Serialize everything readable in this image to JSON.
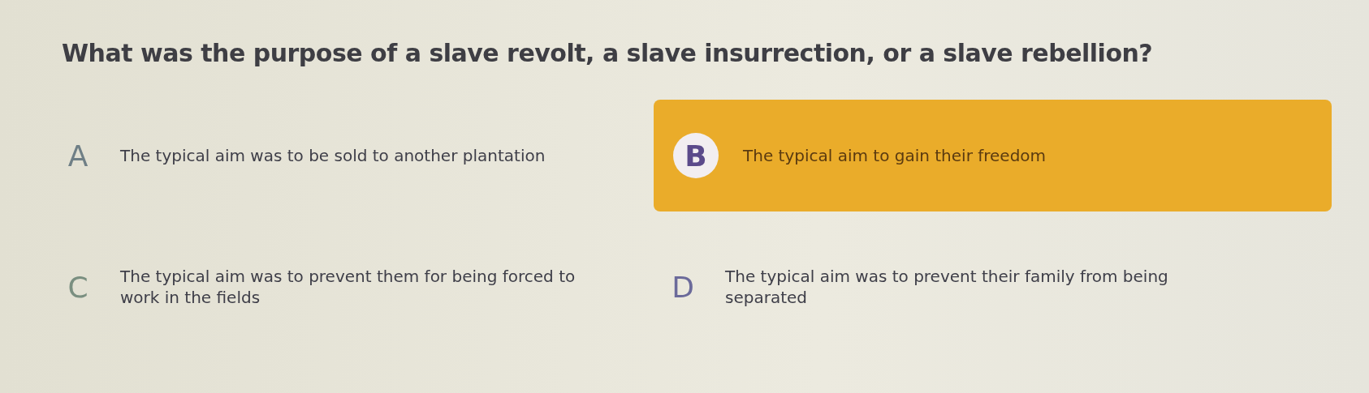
{
  "question": "What was the purpose of a slave revolt, a slave insurrection, or a slave rebellion?",
  "options": [
    {
      "letter": "A",
      "text": "The typical aim was to be sold to another plantation",
      "selected": false,
      "color": "#6f7f86"
    },
    {
      "letter": "B",
      "text": "The typical aim to gain their freedom",
      "selected": true,
      "color": "#5b4a8a"
    },
    {
      "letter": "C",
      "text": "The typical aim was to prevent them for being forced to work in the fields",
      "selected": false,
      "color": "#7a8f80"
    },
    {
      "letter": "D",
      "text": "The typical aim was to prevent their family from being separated",
      "selected": false,
      "color": "#6b6a9a"
    }
  ]
}
